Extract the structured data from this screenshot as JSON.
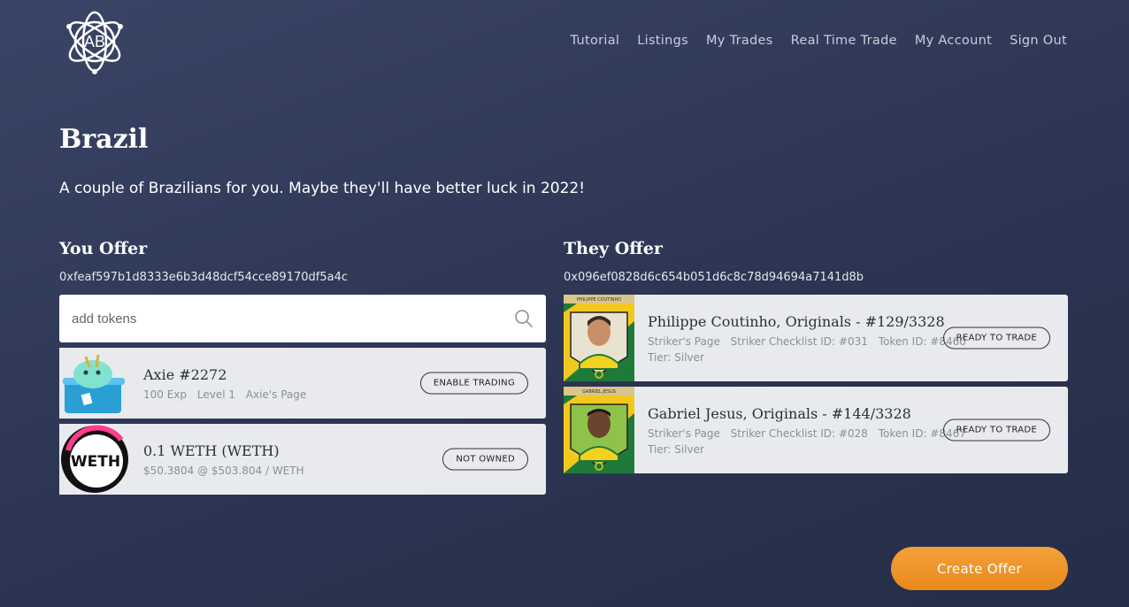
{
  "brand": {
    "logo_text": "AB"
  },
  "nav": {
    "tutorial": "Tutorial",
    "listings": "Listings",
    "my_trades": "My Trades",
    "real_time_trade": "Real Time Trade",
    "my_account": "My Account",
    "sign_out": "Sign Out"
  },
  "page": {
    "title": "Brazil",
    "description": "A couple of Brazilians for you. Maybe they'll have better luck in 2022!"
  },
  "you_offer": {
    "heading": "You Offer",
    "address": "0xfeaf597b1d8333e6b3d48dcf54cce89170df5a4c",
    "search_placeholder": "add tokens",
    "items": [
      {
        "name": "Axie #2272",
        "meta": [
          "100 Exp",
          "Level 1",
          "Axie's Page"
        ],
        "button": "ENABLE TRADING"
      },
      {
        "name": "0.1 WETH (WETH)",
        "meta": [
          "$50.3804 @ $503.804 / WETH"
        ],
        "button": "NOT OWNED",
        "logo_text": "WETH"
      }
    ]
  },
  "they_offer": {
    "heading": "They Offer",
    "address": "0x096ef0828d6c654b051d6c8c78d94694a7141d8b",
    "items": [
      {
        "name": "Philippe Coutinho, Originals - #129/3328",
        "banner": "PHILIPPE COUTINHO",
        "meta": [
          "Striker's Page",
          "Striker Checklist ID: #031",
          "Token ID: #8460"
        ],
        "tier": "Tier: Silver",
        "button": "READY TO TRADE"
      },
      {
        "name": "Gabriel Jesus, Originals - #144/3328",
        "banner": "GABRIEL JESUS",
        "meta": [
          "Striker's Page",
          "Striker Checklist ID: #028",
          "Token ID: #8467"
        ],
        "tier": "Tier: Silver",
        "button": "READY TO TRADE"
      }
    ]
  },
  "actions": {
    "create_offer": "Create Offer"
  },
  "colors": {
    "accent": "#f09a2e",
    "background": "#2f3856",
    "card": "#e8eaee"
  }
}
